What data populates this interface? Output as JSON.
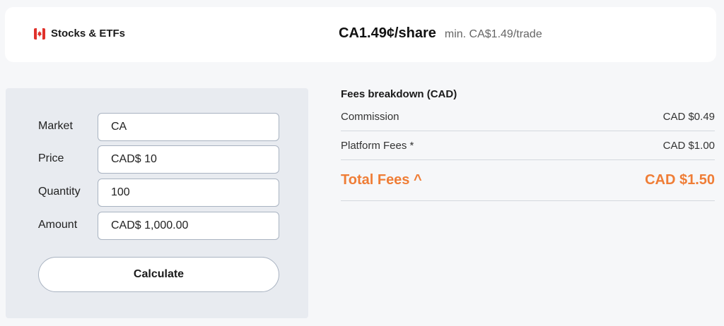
{
  "header": {
    "product_label": "Stocks & ETFs",
    "rate": "CA1.49¢/share",
    "min_fee": "min. CA$1.49/trade",
    "flag_icon": "canada-flag-icon"
  },
  "calculator": {
    "fields": [
      {
        "label": "Market",
        "value": "CA"
      },
      {
        "label": "Price",
        "value": "CAD$ 10"
      },
      {
        "label": "Quantity",
        "value": "100"
      },
      {
        "label": "Amount",
        "value": "CAD$ 1,000.00"
      }
    ],
    "button_label": "Calculate"
  },
  "fees": {
    "title": "Fees breakdown (CAD)",
    "rows": [
      {
        "label": "Commission",
        "value": "CAD $0.49"
      },
      {
        "label": "Platform Fees *",
        "value": "CAD $1.00"
      }
    ],
    "total_label": "Total Fees ^",
    "total_value": "CAD $1.50"
  },
  "colors": {
    "accent": "#ef7d36",
    "panel_bg": "#e8ebf0",
    "flag_red": "#e0312b"
  }
}
